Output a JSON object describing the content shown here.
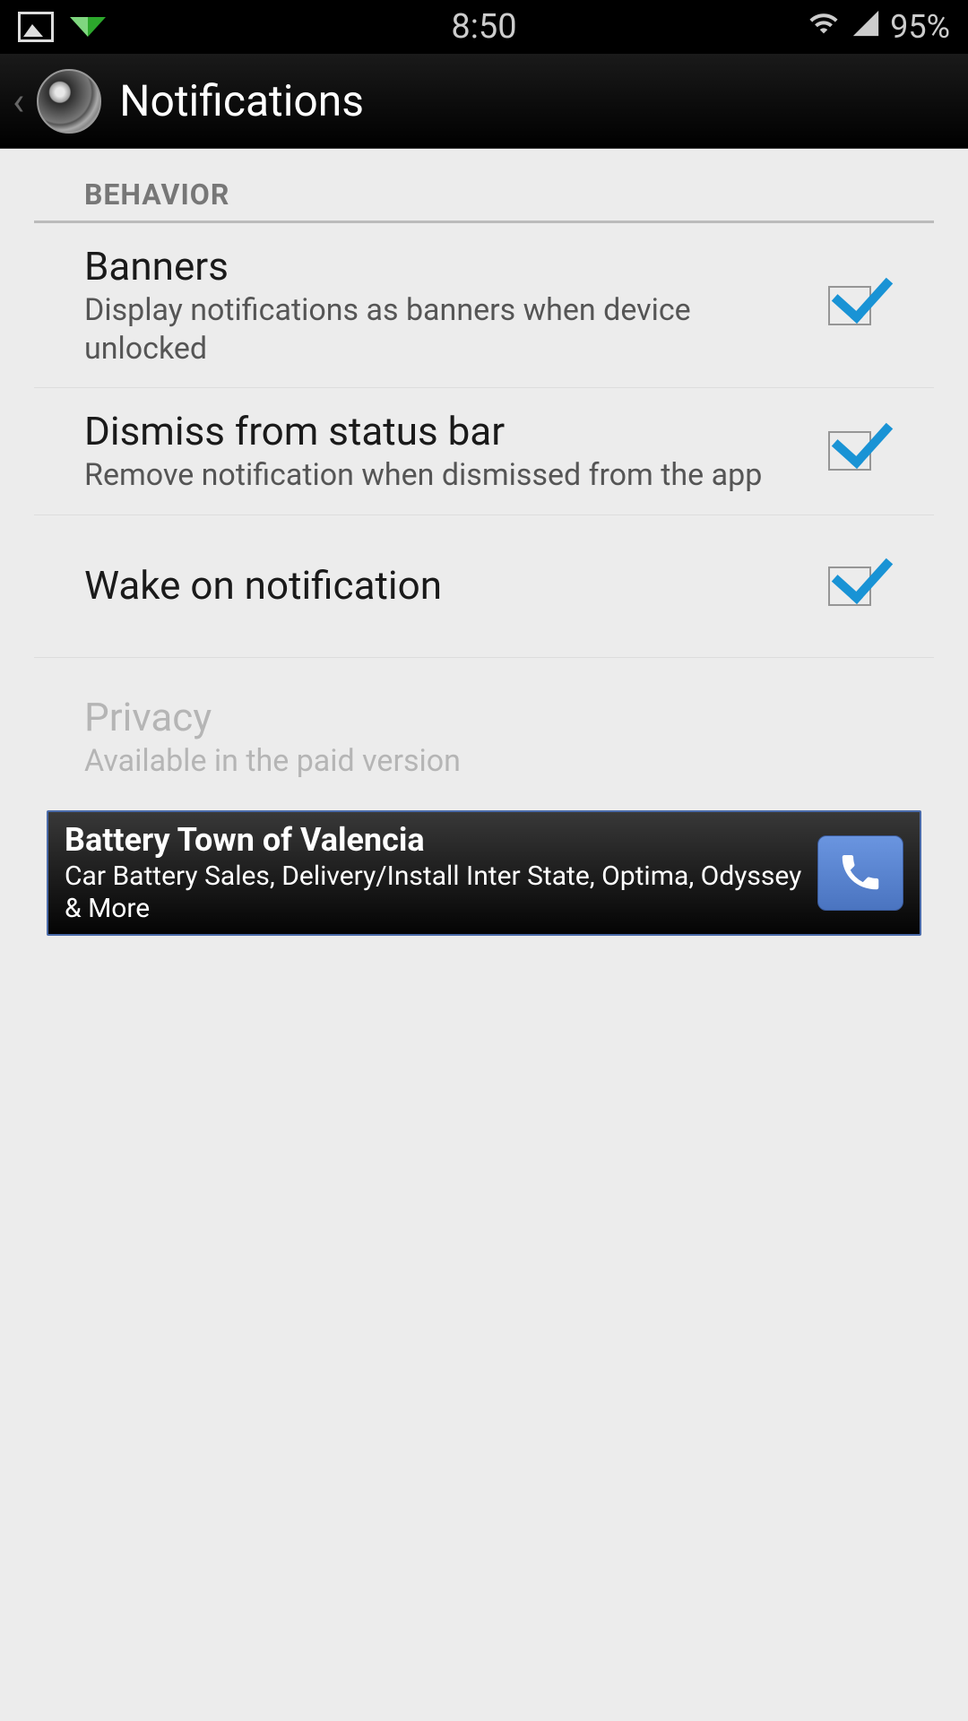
{
  "status_bar": {
    "time": "8:50",
    "battery": "95%"
  },
  "action_bar": {
    "title": "Notifications"
  },
  "section": {
    "header": "BEHAVIOR"
  },
  "items": {
    "banners": {
      "title": "Banners",
      "sub": "Display notifications as banners when device unlocked",
      "checked": true
    },
    "dismiss": {
      "title": "Dismiss from status bar",
      "sub": "Remove notification when dismissed from the app",
      "checked": true
    },
    "wake": {
      "title": "Wake on notification",
      "checked": true
    },
    "privacy": {
      "title": "Privacy",
      "sub": "Available in the paid version"
    }
  },
  "ad": {
    "title": "Battery Town of Valencia",
    "body": "Car Battery Sales, Delivery/Install Inter State, Optima, Odyssey & More"
  }
}
